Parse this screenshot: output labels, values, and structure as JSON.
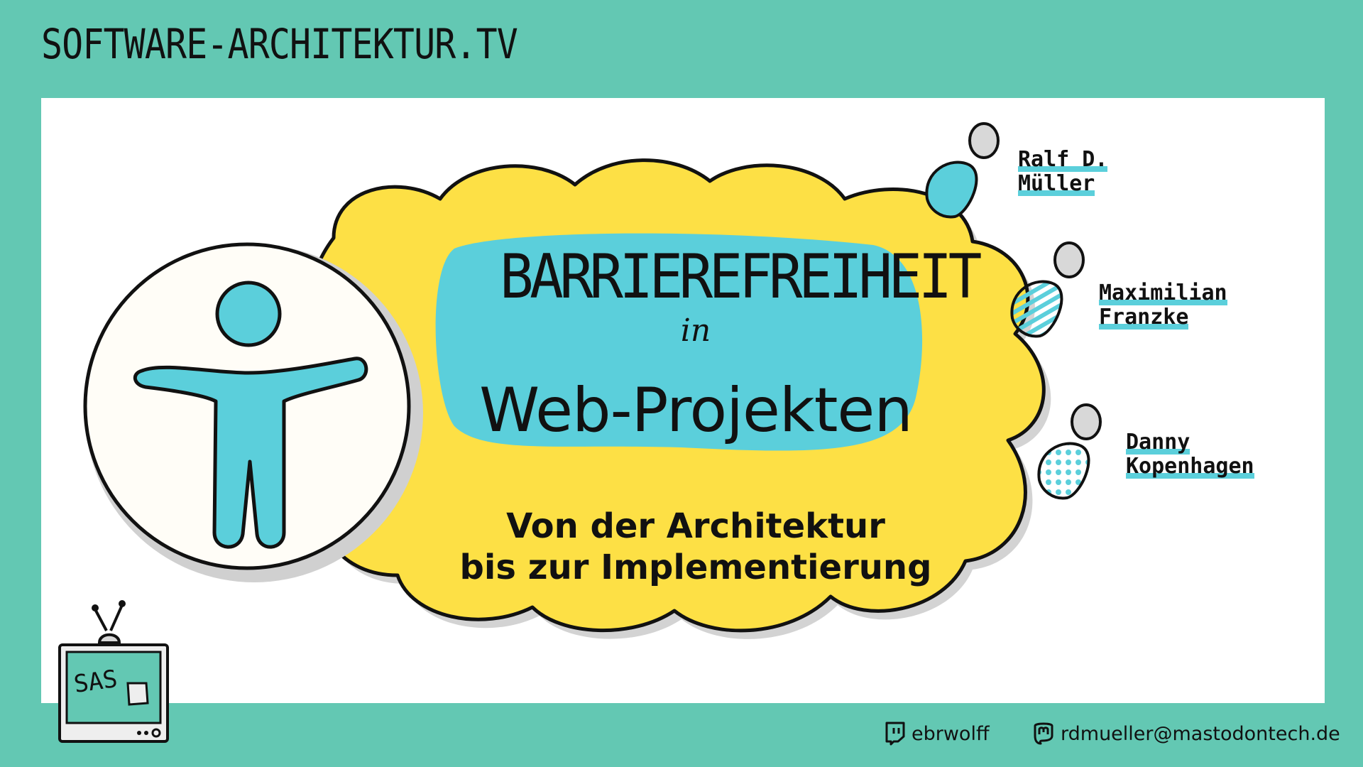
{
  "header": {
    "site_title": "SOFTWARE-ARCHITEKTUR.TV"
  },
  "episode": {
    "title_line1": "BARRIEREFREIHEIT",
    "title_connector": "in",
    "title_line2": "Web-Projekten",
    "subtitle_line1": "Von der Architektur",
    "subtitle_line2": "bis zur Implementierung"
  },
  "speakers": [
    {
      "first": "Ralf D.",
      "last": "Müller",
      "pattern": "solid"
    },
    {
      "first": "Maximilian",
      "last": "Franzke",
      "pattern": "stripes"
    },
    {
      "first": "Danny",
      "last": "Kopenhagen",
      "pattern": "dots"
    }
  ],
  "footer": {
    "twitch_handle": "ebrwolff",
    "mastodon_handle": "rdmueller@mastodontech.de"
  },
  "logo": {
    "text": "SAS",
    "code_glyph": "</>"
  },
  "colors": {
    "frame": "#63c8b3",
    "cloud": "#fde045",
    "accent": "#5bcfdb",
    "ink": "#111111"
  },
  "icons": {
    "accessibility": "accessibility-person-icon",
    "twitch": "twitch-icon",
    "mastodon": "mastodon-icon",
    "tv": "tv-icon"
  }
}
